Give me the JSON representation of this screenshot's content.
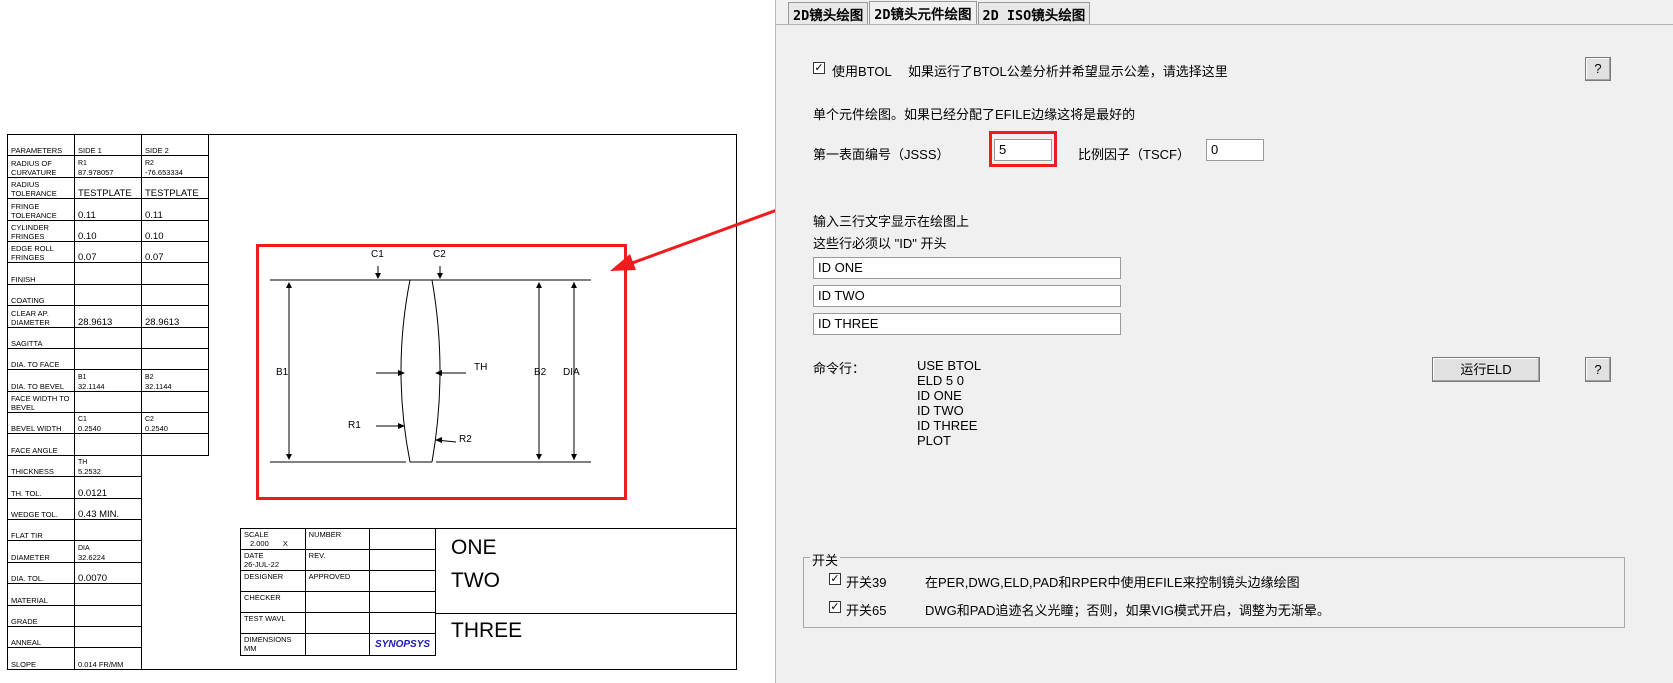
{
  "drawing": {
    "params": {
      "headers": [
        "PARAMETERS",
        "SIDE 1",
        "SIDE 2"
      ],
      "rows": [
        {
          "label": "RADIUS OF CURVATURE",
          "s1a": "R1",
          "s1b": "87.978057",
          "s2a": "R2",
          "s2b": "-76.653334"
        },
        {
          "label": "RADIUS TOLERANCE",
          "s1a": "",
          "s1b": "TESTPLATE",
          "s2a": "",
          "s2b": "TESTPLATE"
        },
        {
          "label": "FRINGE TOLERANCE",
          "s1a": "",
          "s1b": "0.11",
          "s2a": "",
          "s2b": "0.11"
        },
        {
          "label": "CYLINDER FRINGES",
          "s1a": "",
          "s1b": "0.10",
          "s2a": "",
          "s2b": "0.10"
        },
        {
          "label": "EDGE ROLL FRINGES",
          "s1a": "",
          "s1b": "0.07",
          "s2a": "",
          "s2b": "0.07"
        },
        {
          "label": "FINISH",
          "s1a": "",
          "s1b": "",
          "s2a": "",
          "s2b": ""
        },
        {
          "label": "COATING",
          "s1a": "",
          "s1b": "",
          "s2a": "",
          "s2b": ""
        },
        {
          "label": "CLEAR AP. DIAMETER",
          "s1a": "",
          "s1b": "28.9613",
          "s2a": "",
          "s2b": "28.9613"
        },
        {
          "label": "SAGITTA",
          "s1a": "",
          "s1b": "",
          "s2a": "",
          "s2b": ""
        },
        {
          "label": "DIA. TO FACE",
          "s1a": "",
          "s1b": "",
          "s2a": "",
          "s2b": ""
        },
        {
          "label": "DIA. TO BEVEL",
          "s1a": "B1",
          "s1b": "32.1144",
          "s2a": "B2",
          "s2b": "32.1144"
        },
        {
          "label": "FACE WIDTH TO BEVEL",
          "s1a": "",
          "s1b": "",
          "s2a": "",
          "s2b": ""
        },
        {
          "label": "BEVEL WIDTH",
          "s1a": "C1",
          "s1b": "0.2540",
          "s2a": "C2",
          "s2b": "0.2540"
        },
        {
          "label": "FACE ANGLE",
          "s1a": "",
          "s1b": "",
          "s2a": "",
          "s2b": ""
        }
      ],
      "single_rows": [
        {
          "label": "THICKNESS",
          "a": "TH",
          "b": "5.2532"
        },
        {
          "label": "TH. TOL.",
          "a": "",
          "b": "0.0121"
        },
        {
          "label": "WEDGE TOL.",
          "a": "",
          "b": "0.43 MIN."
        },
        {
          "label": "FLAT TIR",
          "a": "",
          "b": ""
        },
        {
          "label": "DIAMETER",
          "a": "DIA",
          "b": "32.6224"
        },
        {
          "label": "DIA. TOL.",
          "a": "",
          "b": "0.0070"
        },
        {
          "label": "MATERIAL",
          "a": "",
          "b": ""
        },
        {
          "label": "GRADE",
          "a": "",
          "b": ""
        },
        {
          "label": "ANNEAL",
          "a": "",
          "b": ""
        },
        {
          "label": "SLOPE",
          "a": "",
          "b": "0.014 FR/MM"
        }
      ]
    },
    "title_block": {
      "scale_label": "SCALE",
      "scale_value": "2.000",
      "scale_x": "X",
      "number_label": "NUMBER",
      "date_label": "DATE",
      "date_value": "26-JUL-22",
      "rev_label": "REV.",
      "designer_label": "DESIGNER",
      "approved_label": "APPROVED",
      "checker_label": "CHECKER",
      "testwavl_label": "TEST WAVL",
      "dimensions_label": "DIMENSIONS",
      "dimensions_value": "MM",
      "logo": "SYNOPSYS",
      "id1": "ONE",
      "id2": "TWO",
      "id3": "THREE"
    },
    "lens_labels": {
      "c1": "C1",
      "c2": "C2",
      "b1": "B1",
      "b2": "B2",
      "dia": "DIA",
      "th": "TH",
      "r1": "R1",
      "r2": "R2"
    }
  },
  "dialog": {
    "tabs": [
      "2D镜头绘图",
      "2D镜头元件绘图",
      "2D ISO镜头绘图"
    ],
    "active_tab": 1,
    "use_btol_label": "使用BTOL",
    "use_btol_checked": true,
    "btol_desc": "如果运行了BTOL公差分析并希望显示公差，请选择这里",
    "help_label": "?",
    "single_elem_desc": "单个元件绘图。如果已经分配了EFILE边缘这将是最好的",
    "jsss_label": "第一表面编号（JSSS）",
    "jsss_value": "5",
    "tscf_label": "比例因子（TSCF）",
    "tscf_value": "0",
    "id_desc1": "输入三行文字显示在绘图上",
    "id_desc2": "这些行必须以 \"ID\" 开头",
    "id_lines": [
      "ID ONE",
      "ID TWO",
      "ID THREE"
    ],
    "cmd_label": "命令行：",
    "cmd_lines": [
      "USE BTOL",
      "ELD 5 0",
      "ID ONE",
      "ID TWO",
      "ID THREE",
      "PLOT"
    ],
    "run_label": "运行ELD",
    "switch_group_label": "开关",
    "switches": [
      {
        "label": "开关39",
        "checked": true,
        "desc": "在PER,DWG,ELD,PAD和RPER中使用EFILE来控制镜头边缘绘图"
      },
      {
        "label": "开关65",
        "checked": true,
        "desc": "DWG和PAD追迹名义光瞳；否则，如果VIG模式开启，调整为无渐晕。"
      }
    ],
    "colors": {
      "highlight": "#ee1c1c",
      "panel": "#f0f0f0"
    }
  }
}
